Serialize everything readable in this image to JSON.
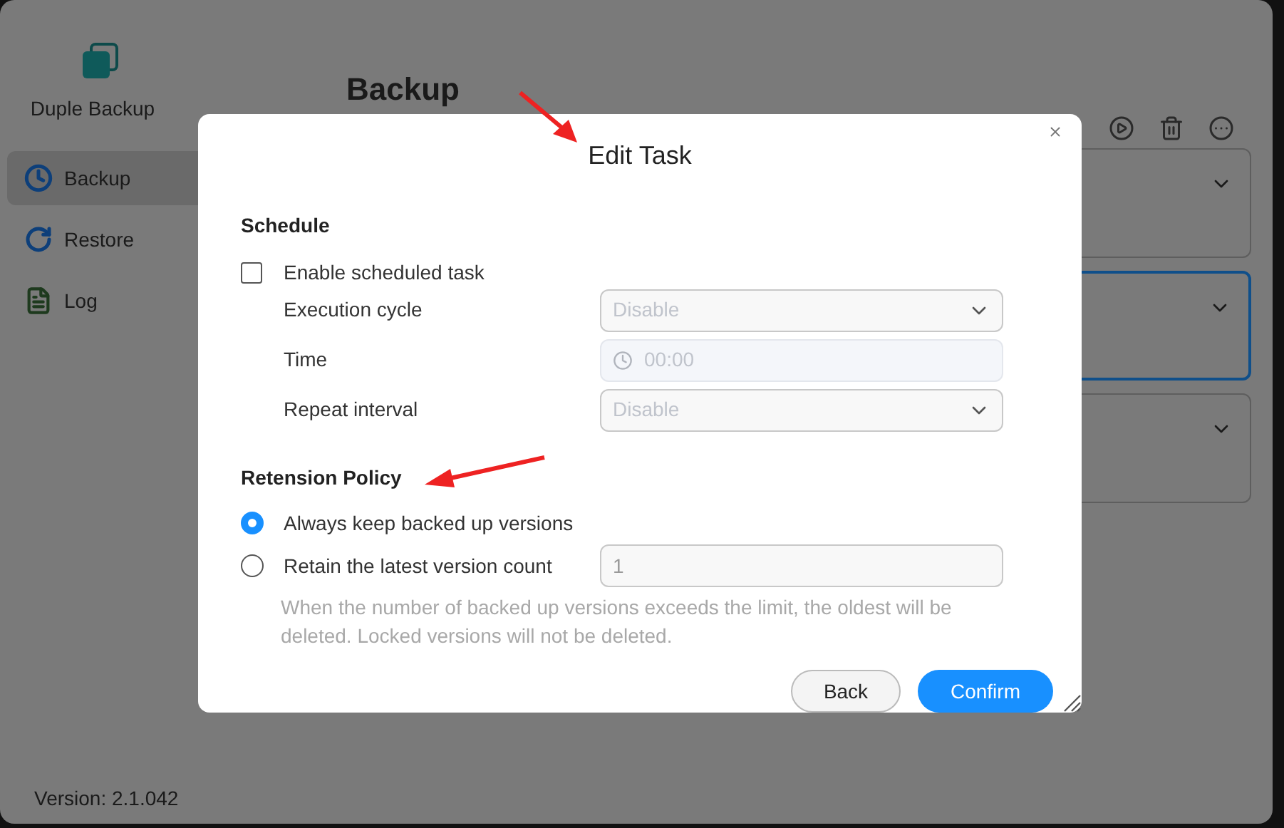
{
  "app": {
    "name": "Duple Backup",
    "version": "Version: 2.1.042"
  },
  "sidebar": {
    "items": [
      {
        "label": "Backup",
        "selected": true,
        "kind": "backup"
      },
      {
        "label": "Restore",
        "selected": false,
        "kind": "restore"
      },
      {
        "label": "Log",
        "selected": false,
        "kind": "log"
      }
    ]
  },
  "page": {
    "title": "Backup"
  },
  "task_cards": [
    {
      "selected": false
    },
    {
      "selected": true
    },
    {
      "selected": false
    }
  ],
  "dialog": {
    "title": "Edit Task",
    "schedule": {
      "heading": "Schedule",
      "enable": {
        "label": "Enable scheduled task",
        "checked": false
      },
      "fields": [
        {
          "label": "Execution cycle",
          "kind": "select",
          "value": "Disable",
          "disabled": true
        },
        {
          "label": "Time",
          "kind": "time",
          "value": "00:00",
          "disabled": true
        },
        {
          "label": "Repeat interval",
          "kind": "select",
          "value": "Disable",
          "disabled": true
        }
      ]
    },
    "retention": {
      "heading": "Retension Policy",
      "options": [
        {
          "label": "Always keep backed up versions",
          "selected": true
        },
        {
          "label": "Retain the latest version count",
          "selected": false
        }
      ],
      "count": {
        "value": "1",
        "disabled": true
      },
      "note": "When the number of backed up versions exceeds the limit, the oldest will be deleted. Locked versions will not be deleted."
    },
    "buttons": [
      {
        "label": "Back",
        "kind": "secondary"
      },
      {
        "label": "Confirm",
        "kind": "primary"
      }
    ]
  }
}
